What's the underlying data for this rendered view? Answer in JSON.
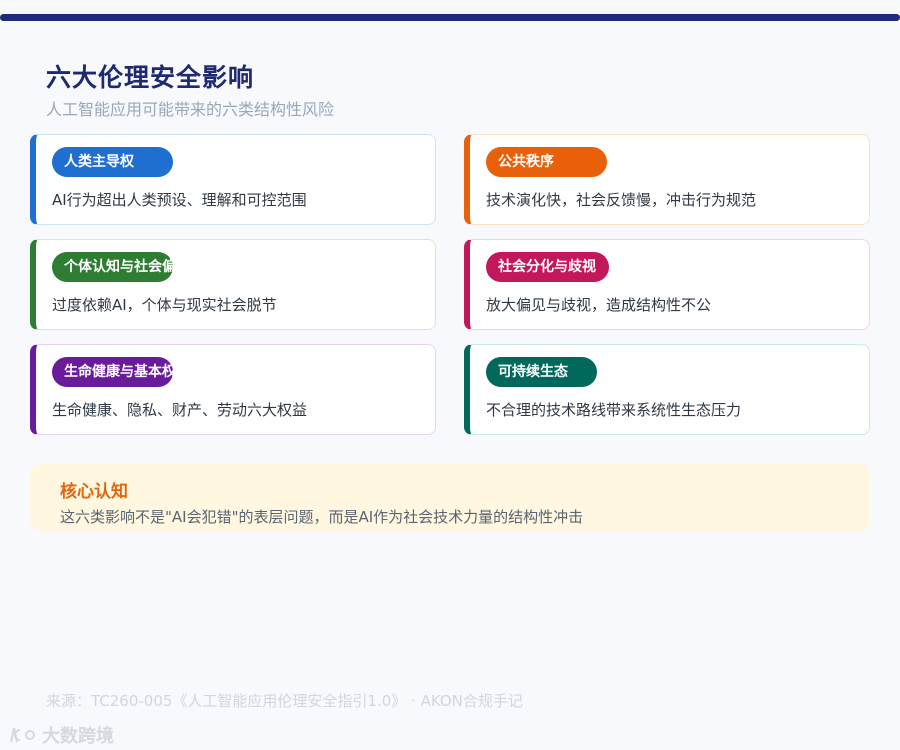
{
  "header": {
    "title": "六大伦理安全影响",
    "subtitle": "人工智能应用可能带来的六类结构性风险"
  },
  "cards": [
    {
      "tag": "人类主导权",
      "desc": "AI行为超出人类预设、理解和可控范围",
      "color": "#1e6fd0",
      "border": "#cfe3f5"
    },
    {
      "tag": "公共秩序",
      "desc": "技术演化快，社会反馈慢，冲击行为规范",
      "color": "#e8600a",
      "border": "#f9e2c8"
    },
    {
      "tag": "个体认知与社会偏",
      "desc": "过度依赖AI，个体与现实社会脱节",
      "color": "#2e7d32",
      "border": "#cfeccc"
    },
    {
      "tag": "社会分化与歧视",
      "desc": "放大偏见与歧视，造成结构性不公",
      "color": "#c2185b",
      "border": "#f6d2e1"
    },
    {
      "tag": "生命健康与基本权",
      "desc": "生命健康、隐私、财产、劳动六大权益",
      "color": "#6a1b9a",
      "border": "#e6d3f2"
    },
    {
      "tag": "可持续生态",
      "desc": "不合理的技术路线带来系统性生态压力",
      "color": "#00695c",
      "border": "#c8ebe6"
    }
  ],
  "insight": {
    "title": "核心认知",
    "text": "这六类影响不是\"AI会犯错\"的表层问题，而是AI作为社会技术力量的结构性冲击"
  },
  "footer": {
    "source": "来源：TC260-005《人工智能应用伦理安全指引1.0》 · AKON合规手记",
    "watermark": "大数跨境"
  }
}
